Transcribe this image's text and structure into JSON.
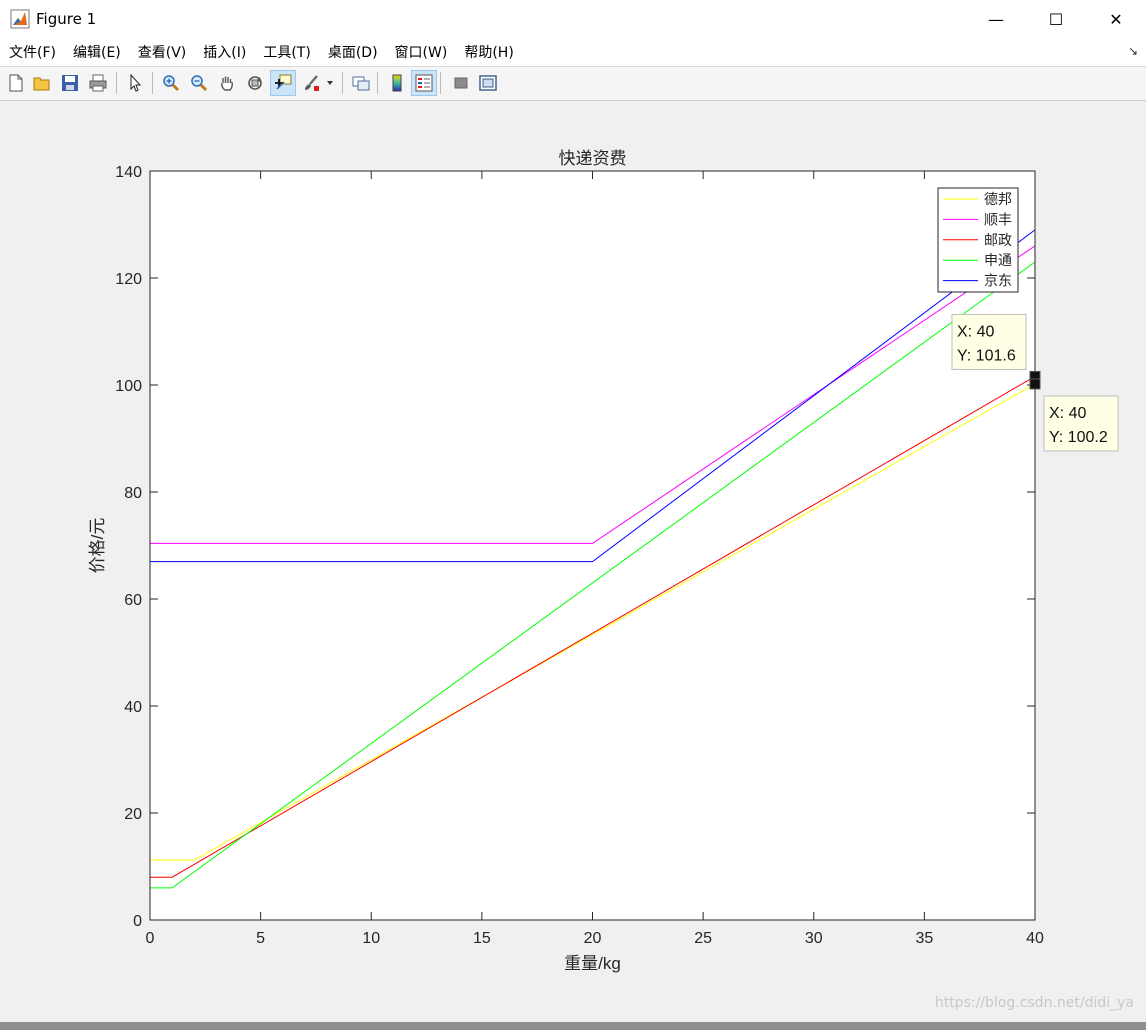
{
  "window": {
    "title": "Figure 1",
    "minimize": "—",
    "maximize": "☐",
    "close": "✕"
  },
  "menu": [
    {
      "label": "文件(F)",
      "name": "menu-file"
    },
    {
      "label": "编辑(E)",
      "name": "menu-edit"
    },
    {
      "label": "查看(V)",
      "name": "menu-view"
    },
    {
      "label": "插入(I)",
      "name": "menu-insert"
    },
    {
      "label": "工具(T)",
      "name": "menu-tools"
    },
    {
      "label": "桌面(D)",
      "name": "menu-desktop"
    },
    {
      "label": "窗口(W)",
      "name": "menu-window"
    },
    {
      "label": "帮助(H)",
      "name": "menu-help"
    }
  ],
  "toolbar": [
    {
      "icon": "new-figure-icon"
    },
    {
      "icon": "open-file-icon"
    },
    {
      "icon": "save-icon"
    },
    {
      "icon": "print-icon"
    },
    {
      "icon": "pointer-icon"
    },
    {
      "icon": "zoom-in-icon"
    },
    {
      "icon": "zoom-out-icon"
    },
    {
      "icon": "pan-hand-icon"
    },
    {
      "icon": "rotate-3d-icon"
    },
    {
      "icon": "data-cursor-icon",
      "active": true
    },
    {
      "icon": "brush-icon"
    },
    {
      "icon": "link-plot-icon"
    },
    {
      "icon": "colorbar-icon"
    },
    {
      "icon": "legend-icon",
      "active": true
    },
    {
      "icon": "hide-plot-tools-icon"
    },
    {
      "icon": "show-plot-tools-icon"
    }
  ],
  "watermark": "https://blog.csdn.net/didi_ya",
  "chart_data": {
    "type": "line",
    "title": "快递资费",
    "xlabel": "重量/kg",
    "ylabel": "价格/元",
    "xlim": [
      0,
      40
    ],
    "ylim": [
      0,
      140
    ],
    "xticks": [
      0,
      5,
      10,
      15,
      20,
      25,
      30,
      35,
      40
    ],
    "yticks": [
      0,
      20,
      40,
      60,
      80,
      100,
      120,
      140
    ],
    "grid": false,
    "legend_position": "top-right",
    "series": [
      {
        "name": "德邦",
        "color": "#ffff00",
        "x": [
          0,
          2,
          40
        ],
        "y": [
          11.2,
          11.2,
          100.2
        ]
      },
      {
        "name": "顺丰",
        "color": "#ff00ff",
        "x": [
          0,
          20,
          40
        ],
        "y": [
          70.4,
          70.4,
          126
        ]
      },
      {
        "name": "邮政",
        "color": "#ff0000",
        "x": [
          0,
          1,
          40
        ],
        "y": [
          8,
          8,
          101.6
        ]
      },
      {
        "name": "申通",
        "color": "#00ff00",
        "x": [
          0,
          1,
          40
        ],
        "y": [
          6,
          6,
          123
        ]
      },
      {
        "name": "京东",
        "color": "#0000ff",
        "x": [
          0,
          20,
          40
        ],
        "y": [
          67,
          67,
          129
        ]
      }
    ],
    "datatips": [
      {
        "x": 40,
        "y": 101.6,
        "x_label": "X: 40",
        "y_label": "Y: 101.6"
      },
      {
        "x": 40,
        "y": 100.2,
        "x_label": "X: 40",
        "y_label": "Y: 100.2"
      }
    ]
  }
}
